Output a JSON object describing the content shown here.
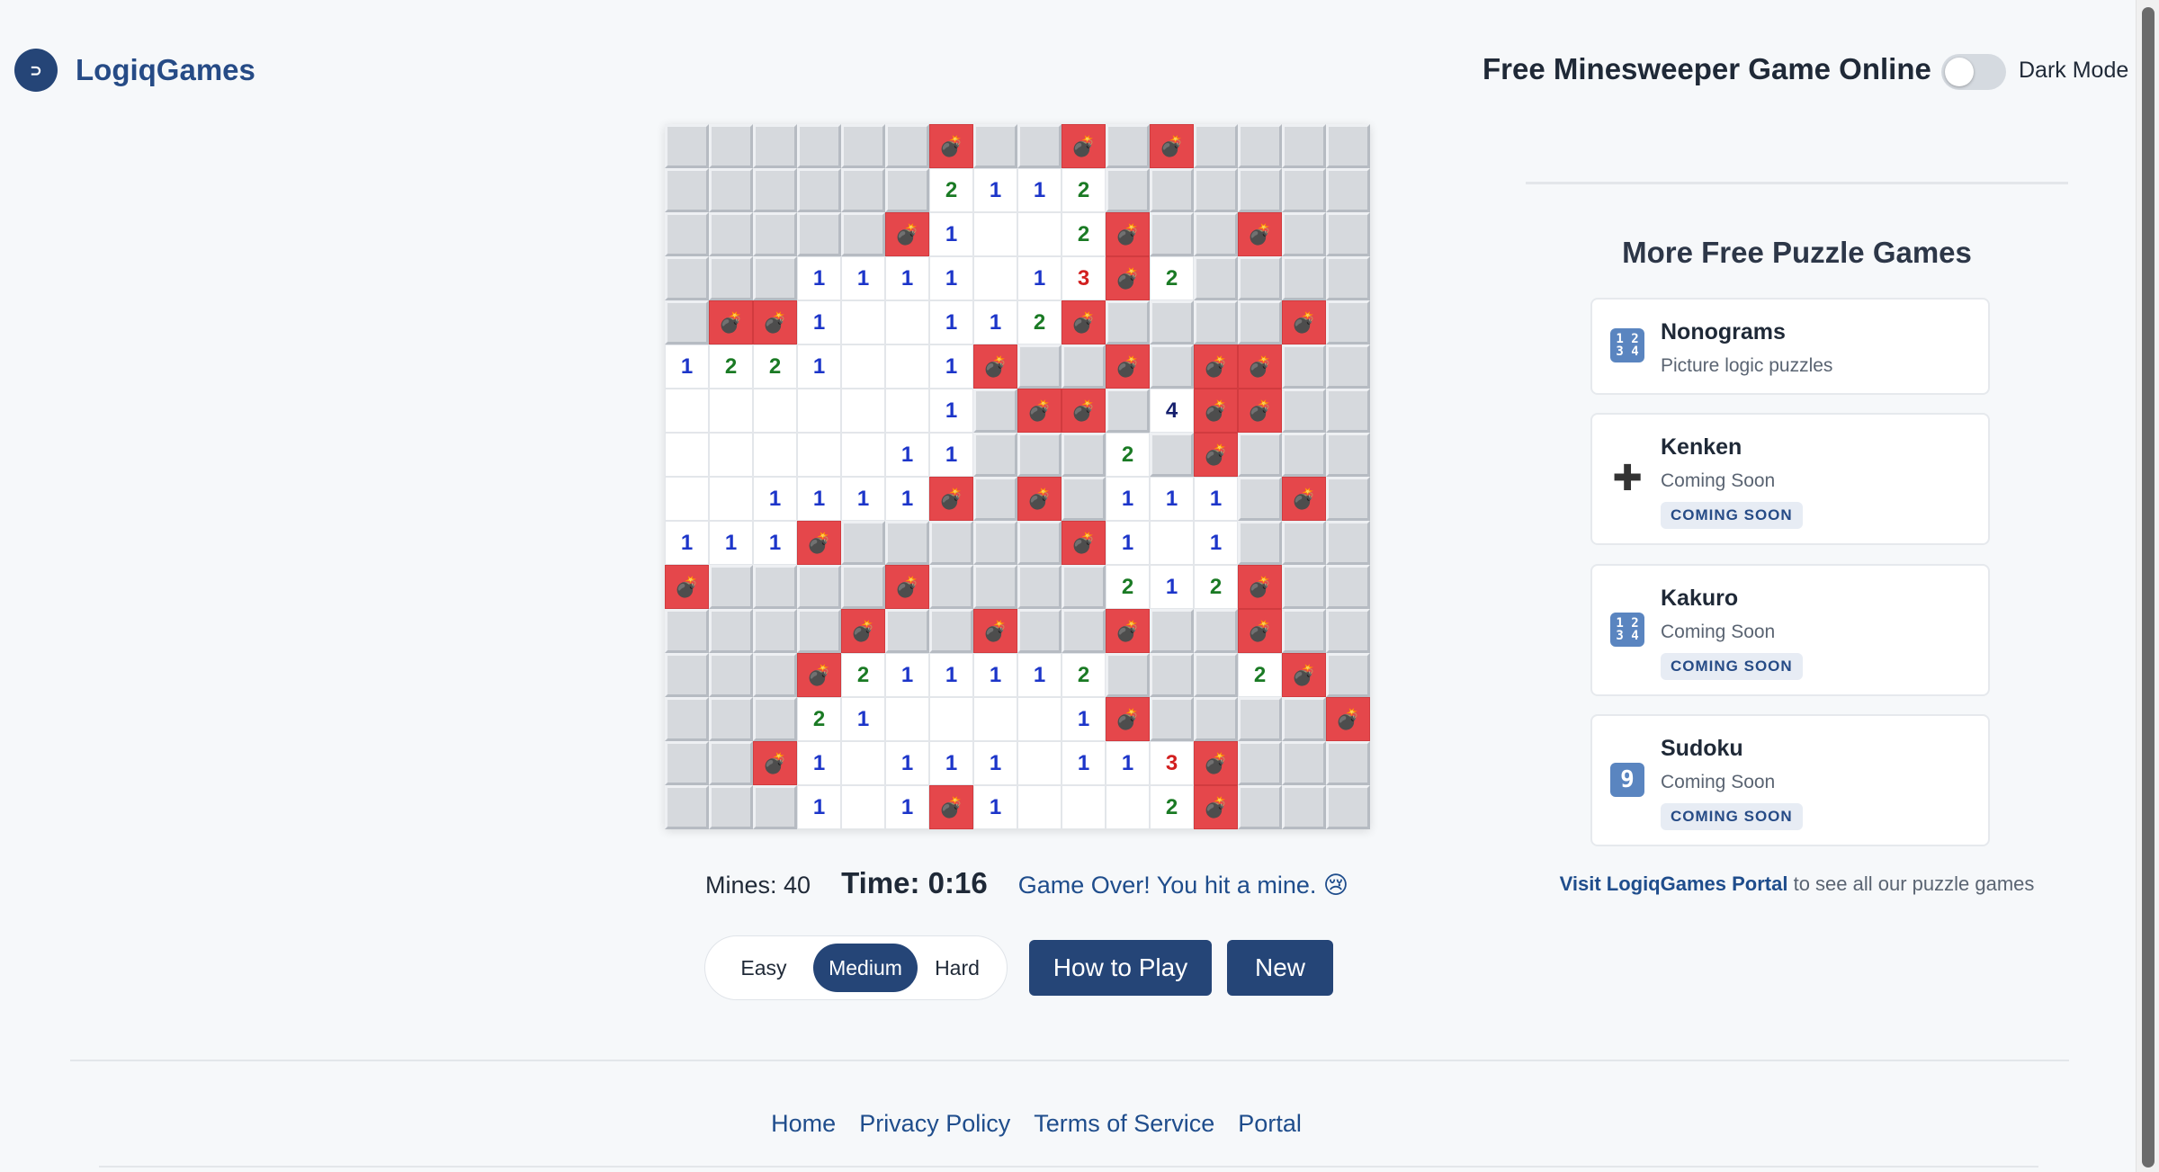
{
  "header": {
    "logo_glyph": "⊃",
    "logo_text": "LogiqGames",
    "page_title": "Free Minesweeper Game Online",
    "dark_mode_label": "Dark Mode",
    "dark_mode_on": false
  },
  "board": {
    "rows": 16,
    "cols": 16,
    "legend": "H = hidden cell, M = mine, . = revealed empty, digits = adjacent mine count",
    "cells": [
      "HHHHHHMHHMHMHHHH",
      "HHHHHH2112HHHHHH",
      "HHHHHM1..2MHHMHH",
      "HHH1111.13M2HHHH",
      "HMM1..112MHHHHMH",
      "1221..1MHHMHMMHH",
      "......1HMMH4MMHH",
      ".....11HHH2HMHHH",
      "..1111MHMH111HMH",
      "111MHHHHHM1.1HHH",
      "MHHHHMHHHH212MHH",
      "HHHHMHHMHHMHHMHH",
      "HHHM211112HHH2MH",
      "HHH21....1MHHHHM",
      "HHM1.111.113MHHH",
      "HHH1.1M1...2MHHH"
    ],
    "mine_glyph": "💣"
  },
  "status": {
    "mines_text": "Mines: 40",
    "time_text": "Time: 0:16",
    "message": "Game Over! You hit a mine. 😢"
  },
  "controls": {
    "difficulties": [
      "Easy",
      "Medium",
      "Hard"
    ],
    "selected_difficulty": "Medium",
    "how_to_play_label": "How to Play",
    "new_label": "New"
  },
  "sidebar": {
    "title": "More Free Puzzle Games",
    "games": [
      {
        "name": "Nonograms",
        "subtitle": "Picture logic puzzles",
        "icon": "keycap-1234-icon",
        "icon_glyph": "12\n34",
        "badge": ""
      },
      {
        "name": "Kenken",
        "subtitle": "Coming Soon",
        "icon": "plus-icon",
        "icon_glyph": "✚",
        "badge": "COMING SOON"
      },
      {
        "name": "Kakuro",
        "subtitle": "Coming Soon",
        "icon": "keycap-1234-icon",
        "icon_glyph": "12\n34",
        "badge": "COMING SOON"
      },
      {
        "name": "Sudoku",
        "subtitle": "Coming Soon",
        "icon": "keycap-9-icon",
        "icon_glyph": "9",
        "badge": "COMING SOON"
      }
    ],
    "portal_link": "Visit LogiqGames Portal",
    "portal_suffix": " to see all our puzzle games"
  },
  "footer": {
    "links": [
      "Home",
      "Privacy Policy",
      "Terms of Service",
      "Portal"
    ]
  },
  "colors": {
    "brand": "#254577",
    "mine_bg": "#e5474b",
    "hidden_cell": "#d6d9dd",
    "num1": "#1c35c9",
    "num2": "#1a7a24",
    "num3": "#d21f1f",
    "num4": "#151f6d"
  }
}
